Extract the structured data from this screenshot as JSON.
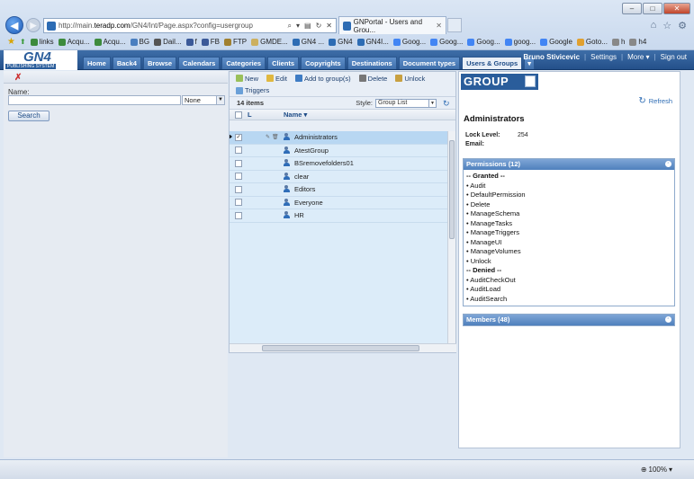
{
  "browser": {
    "url_prefix": "http://main.",
    "url_domain": "teradp.com",
    "url_path": "/GN4/Int/Page.aspx?config=usergroup",
    "tab_title": "GNPortal - Users and Grou...",
    "zoom": "100%",
    "favorites": [
      "links",
      "Acqu...",
      "Acqu...",
      "BG",
      "Dail...",
      "f",
      "FB",
      "FTP",
      "GMDE...",
      "GN4 ...",
      "GN4",
      "GN4I...",
      "Goog...",
      "Goog...",
      "Goog...",
      "goog...",
      "Google",
      "Goto...",
      "h",
      "h4"
    ]
  },
  "app": {
    "logo": "GN4",
    "logo_sub": "PUBLISHING SYSTEM",
    "nav": [
      "Home",
      "Back4",
      "Browse",
      "Calendars",
      "Categories",
      "Clients",
      "Copyrights",
      "Destinations",
      "Document types",
      "Users & Groups"
    ],
    "active_tab": "Users & Groups",
    "user": "Bruno Stivicevic",
    "settings": "Settings",
    "more": "More ▾",
    "signout": "Sign out"
  },
  "search": {
    "name_label": "Name:",
    "select_value": "None",
    "search_button": "Search"
  },
  "list": {
    "toolbar": [
      "New",
      "Edit",
      "Add to group(s)",
      "Delete",
      "Unlock"
    ],
    "triggers": "Triggers",
    "count": "14 items",
    "style_label": "Style:",
    "style_value": "Group List",
    "col_l": "L",
    "col_name": "Name ▾",
    "rows": [
      "Administrators",
      "AtestGroup",
      "BSremovefolders01",
      "clear",
      "Editors",
      "Everyone",
      "HR"
    ]
  },
  "detail": {
    "badge": "GROUP",
    "refresh": "Refresh",
    "title": "Administrators",
    "lock_label": "Lock Level:",
    "lock_value": "254",
    "email_label": "Email:",
    "permissions_header": "Permissions (12)",
    "granted_header": "-- Granted --",
    "granted": [
      "• Audit",
      "• DefaultPermission",
      "• Delete",
      "• ManageSchema",
      "• ManageTasks",
      "• ManageTriggers",
      "• ManageUI",
      "• ManageVolumes",
      "• Unlock"
    ],
    "denied_header": "-- Denied --",
    "denied": [
      "• AuditCheckOut",
      "• AuditLoad",
      "• AuditSearch"
    ],
    "members_header": "Members (48)"
  },
  "colors": {
    "header_blue": "#24508a",
    "selected_row": "#b8d7f2",
    "list_bg": "#dcecf9",
    "panel_header": "#4f80bd"
  }
}
